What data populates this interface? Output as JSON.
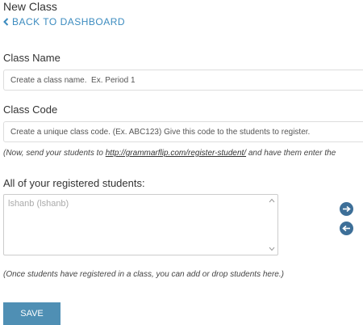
{
  "page": {
    "title": "New Class",
    "back_link": "BACK TO DASHBOARD"
  },
  "class_name": {
    "label": "Class Name",
    "placeholder": "Create a class name.  Ex. Period 1",
    "value": ""
  },
  "class_code": {
    "label": "Class Code",
    "placeholder": "Create a unique class code. (Ex. ABC123) Give this code to the students to register.",
    "value": "",
    "note_prefix": "(Now, send your students to ",
    "note_link": "http://grammarflip.com/register-student/",
    "note_suffix": " and have them enter the"
  },
  "students": {
    "label": "All of your registered students:",
    "items": [
      "lshanb (lshanb)"
    ],
    "note": "(Once students have registered in a class, you can add or drop students here.)"
  },
  "actions": {
    "save_label": "SAVE",
    "add_icon": "arrow-right-circle-icon",
    "remove_icon": "arrow-left-circle-icon"
  },
  "colors": {
    "accent": "#3b8bbf",
    "save_button": "#4f8fb4",
    "move_button": "#3d6f98"
  }
}
